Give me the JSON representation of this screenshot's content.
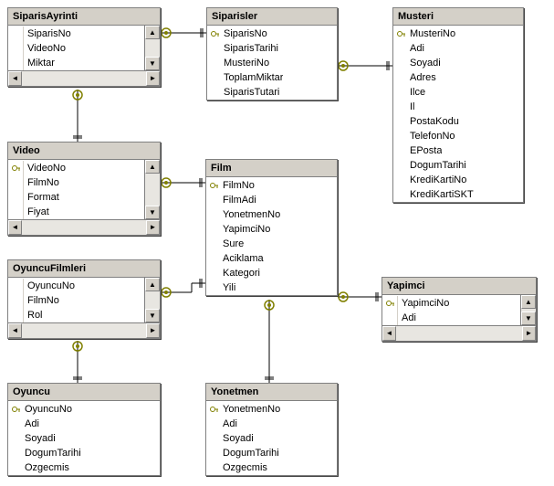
{
  "tables": [
    {
      "name": "SiparisAyrinti",
      "fields": [
        {
          "name": "SiparisNo",
          "pk": false
        },
        {
          "name": "VideoNo",
          "pk": false
        },
        {
          "name": "Miktar",
          "pk": false
        }
      ],
      "scrollbars": true
    },
    {
      "name": "Siparisler",
      "fields": [
        {
          "name": "SiparisNo",
          "pk": true
        },
        {
          "name": "SiparisTarihi",
          "pk": false
        },
        {
          "name": "MusteriNo",
          "pk": false
        },
        {
          "name": "ToplamMiktar",
          "pk": false
        },
        {
          "name": "SiparisTutari",
          "pk": false
        }
      ],
      "scrollbars": false
    },
    {
      "name": "Musteri",
      "fields": [
        {
          "name": "MusteriNo",
          "pk": true
        },
        {
          "name": "Adi",
          "pk": false
        },
        {
          "name": "Soyadi",
          "pk": false
        },
        {
          "name": "Adres",
          "pk": false
        },
        {
          "name": "Ilce",
          "pk": false
        },
        {
          "name": "Il",
          "pk": false
        },
        {
          "name": "PostaKodu",
          "pk": false
        },
        {
          "name": "TelefonNo",
          "pk": false
        },
        {
          "name": "EPosta",
          "pk": false
        },
        {
          "name": "DogumTarihi",
          "pk": false
        },
        {
          "name": "KrediKartiNo",
          "pk": false
        },
        {
          "name": "KrediKartiSKT",
          "pk": false
        }
      ],
      "scrollbars": false
    },
    {
      "name": "Video",
      "fields": [
        {
          "name": "VideoNo",
          "pk": true
        },
        {
          "name": "FilmNo",
          "pk": false
        },
        {
          "name": "Format",
          "pk": false
        },
        {
          "name": "Fiyat",
          "pk": false
        }
      ],
      "scrollbars": true
    },
    {
      "name": "Film",
      "fields": [
        {
          "name": "FilmNo",
          "pk": true
        },
        {
          "name": "FilmAdi",
          "pk": false
        },
        {
          "name": "YonetmenNo",
          "pk": false
        },
        {
          "name": "YapimciNo",
          "pk": false
        },
        {
          "name": "Sure",
          "pk": false
        },
        {
          "name": "Aciklama",
          "pk": false
        },
        {
          "name": "Kategori",
          "pk": false
        },
        {
          "name": "Yili",
          "pk": false
        }
      ],
      "scrollbars": false
    },
    {
      "name": "OyuncuFilmleri",
      "fields": [
        {
          "name": "OyuncuNo",
          "pk": false
        },
        {
          "name": "FilmNo",
          "pk": false
        },
        {
          "name": "Rol",
          "pk": false
        }
      ],
      "scrollbars": true
    },
    {
      "name": "Yapimci",
      "fields": [
        {
          "name": "YapimciNo",
          "pk": true
        },
        {
          "name": "Adi",
          "pk": false
        }
      ],
      "scrollbars": true
    },
    {
      "name": "Oyuncu",
      "fields": [
        {
          "name": "OyuncuNo",
          "pk": true
        },
        {
          "name": "Adi",
          "pk": false
        },
        {
          "name": "Soyadi",
          "pk": false
        },
        {
          "name": "DogumTarihi",
          "pk": false
        },
        {
          "name": "Ozgecmis",
          "pk": false
        }
      ],
      "scrollbars": false
    },
    {
      "name": "Yonetmen",
      "fields": [
        {
          "name": "YonetmenNo",
          "pk": true
        },
        {
          "name": "Adi",
          "pk": false
        },
        {
          "name": "Soyadi",
          "pk": false
        },
        {
          "name": "DogumTarihi",
          "pk": false
        },
        {
          "name": "Ozgecmis",
          "pk": false
        }
      ],
      "scrollbars": false
    }
  ],
  "relationships": [
    {
      "from": "SiparisAyrinti",
      "to": "Siparisler",
      "type": "many-to-one"
    },
    {
      "from": "Siparisler",
      "to": "Musteri",
      "type": "many-to-one"
    },
    {
      "from": "SiparisAyrinti",
      "to": "Video",
      "type": "many-to-one"
    },
    {
      "from": "Video",
      "to": "Film",
      "type": "many-to-one"
    },
    {
      "from": "OyuncuFilmleri",
      "to": "Film",
      "type": "many-to-one"
    },
    {
      "from": "Film",
      "to": "Yapimci",
      "type": "many-to-one"
    },
    {
      "from": "Film",
      "to": "Yonetmen",
      "type": "many-to-one"
    },
    {
      "from": "OyuncuFilmleri",
      "to": "Oyuncu",
      "type": "many-to-one"
    }
  ],
  "colors": {
    "titleBg": "#d4d0c8",
    "border": "#808080",
    "keyIcon": "#808000"
  }
}
